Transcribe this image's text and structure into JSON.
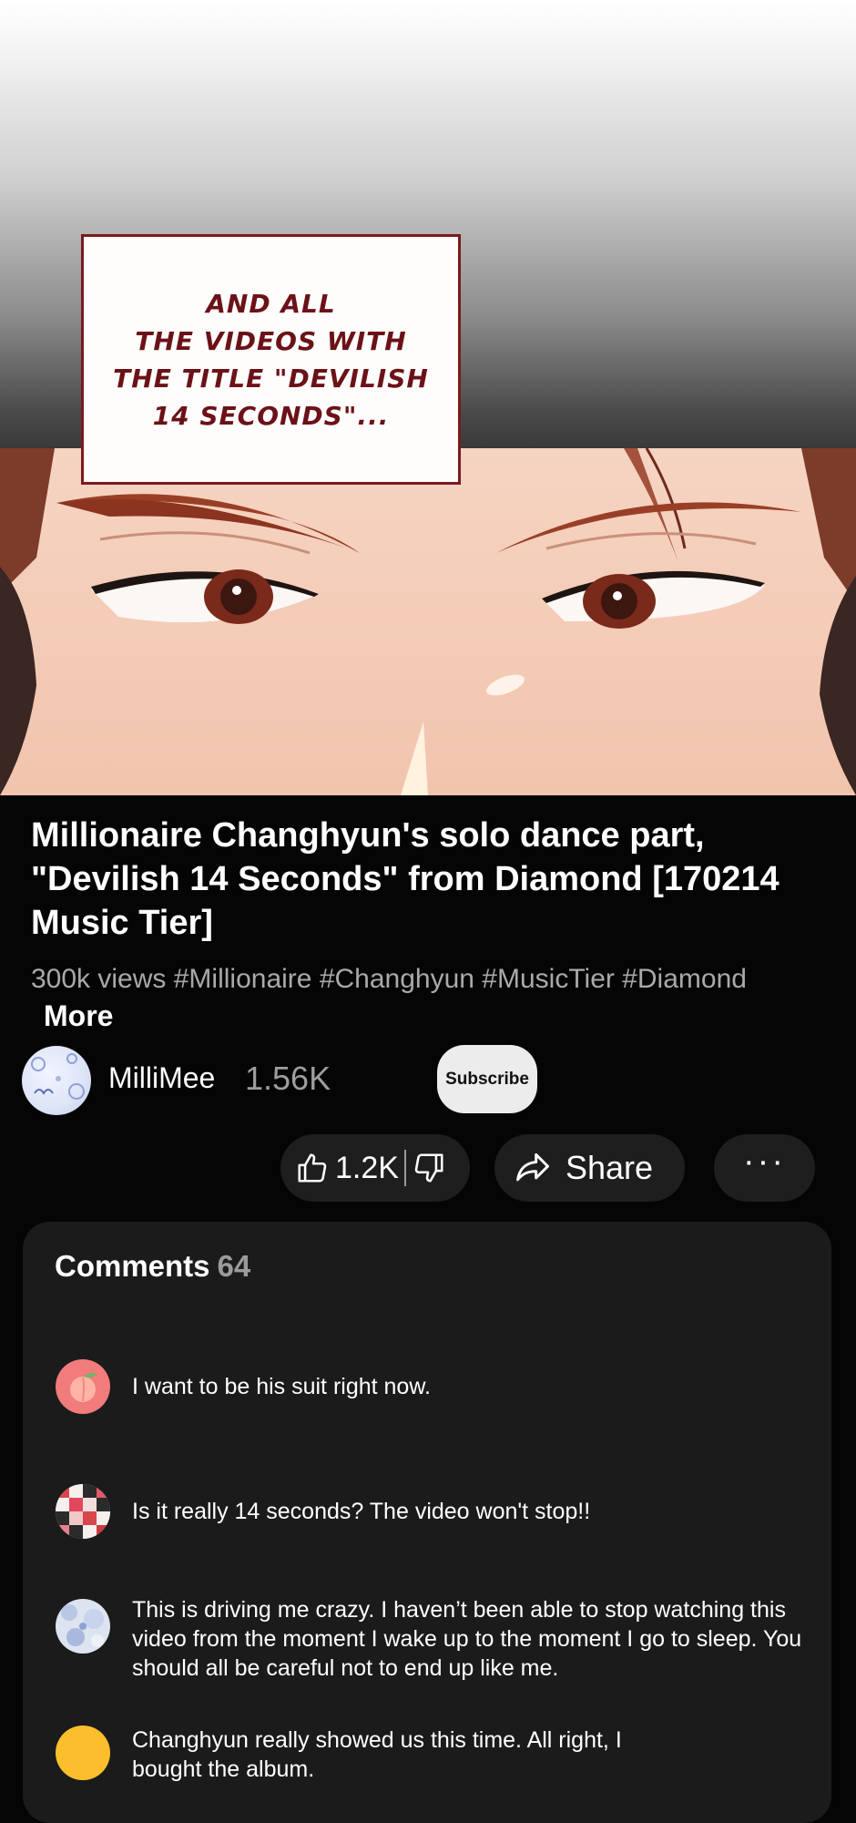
{
  "comic": {
    "caption": "AND ALL\nTHE VIDEOS WITH\nTHE TITLE \"DEVILISH\n14 SECONDS\"..."
  },
  "video": {
    "title": "Millionaire Changhyun's solo dance part, \"Devilish 14 Seconds\" from Diamond [170214 Music Tier]",
    "views": "300k views",
    "hashtags": "#Millionaire #Changhyun #MusicTier #Diamond",
    "more_label": "More"
  },
  "channel": {
    "name": "MilliMee",
    "subscribers": "1.56K",
    "subscribe_label": "Subscribe"
  },
  "actions": {
    "like_count": "1.2K",
    "share_label": "Share",
    "more_label": "···"
  },
  "comments": {
    "title": "Comments",
    "count": "64",
    "items": [
      {
        "text": "I want to be his suit right now.",
        "avatar": "peach-icon"
      },
      {
        "text": "Is it really 14 seconds? The video won't stop!!",
        "avatar": "checkered-pattern"
      },
      {
        "text": "This is driving me crazy. I haven’t been able to stop watching this video from the moment I wake up to the moment I go to sleep. You should all be careful not to end up like me.",
        "avatar": "blue-floral-pattern"
      },
      {
        "text": "Changhyun really showed us this time. All right, I bought the album.",
        "avatar": "yellow-circle"
      }
    ]
  },
  "colors": {
    "background": "#050505",
    "caption_text": "#6b1218",
    "card": "#1b1b1b",
    "pill": "#1e1e1e",
    "muted_text": "#a9a9a9"
  }
}
